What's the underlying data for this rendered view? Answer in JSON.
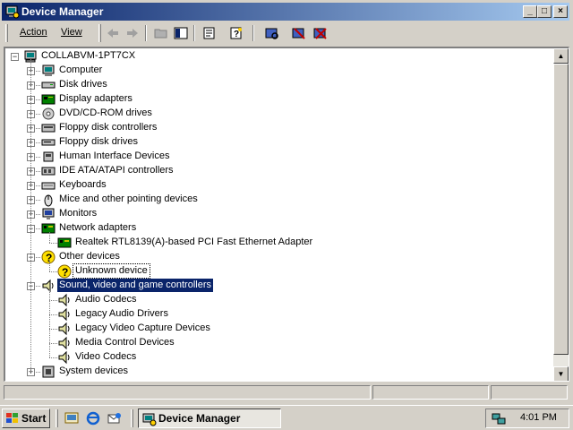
{
  "window": {
    "title": "Device Manager"
  },
  "menu": {
    "action": "Action",
    "view": "View"
  },
  "toolbar": {
    "buttons": [
      "back-icon",
      "forward-icon",
      "up-folder-icon",
      "show-hide-tree-icon",
      "properties-icon",
      "help-icon",
      "scan-hardware-icon",
      "disable-device-icon",
      "uninstall-device-icon"
    ]
  },
  "tree": {
    "root": "COLLABVM-1PT7CX",
    "categories": [
      {
        "label": "Computer",
        "icon": "computer-icon",
        "state": "collapsed"
      },
      {
        "label": "Disk drives",
        "icon": "disk-drive-icon",
        "state": "collapsed"
      },
      {
        "label": "Display adapters",
        "icon": "display-adapter-icon",
        "state": "collapsed"
      },
      {
        "label": "DVD/CD-ROM drives",
        "icon": "cdrom-icon",
        "state": "collapsed"
      },
      {
        "label": "Floppy disk controllers",
        "icon": "floppy-controller-icon",
        "state": "collapsed"
      },
      {
        "label": "Floppy disk drives",
        "icon": "floppy-drive-icon",
        "state": "collapsed"
      },
      {
        "label": "Human Interface Devices",
        "icon": "hid-icon",
        "state": "collapsed"
      },
      {
        "label": "IDE ATA/ATAPI controllers",
        "icon": "ide-controller-icon",
        "state": "collapsed"
      },
      {
        "label": "Keyboards",
        "icon": "keyboard-icon",
        "state": "collapsed"
      },
      {
        "label": "Mice and other pointing devices",
        "icon": "mouse-icon",
        "state": "collapsed"
      },
      {
        "label": "Monitors",
        "icon": "monitor-icon",
        "state": "collapsed"
      },
      {
        "label": "Network adapters",
        "icon": "network-adapter-icon",
        "state": "expanded",
        "children": [
          "Realtek RTL8139(A)-based PCI Fast Ethernet Adapter"
        ]
      },
      {
        "label": "Other devices",
        "icon": "question-icon",
        "state": "expanded",
        "children": [
          "Unknown device"
        ]
      },
      {
        "label": "Sound, video and game controllers",
        "icon": "speaker-icon",
        "state": "expanded",
        "selected": true,
        "children": [
          "Audio Codecs",
          "Legacy Audio Drivers",
          "Legacy Video Capture Devices",
          "Media Control Devices",
          "Video Codecs"
        ]
      },
      {
        "label": "System devices",
        "icon": "system-device-icon",
        "state": "collapsed"
      }
    ]
  },
  "taskbar": {
    "start": "Start",
    "quicklaunch": [
      "show-desktop-icon",
      "internet-explorer-icon",
      "outlook-express-icon"
    ],
    "task": "Device Manager",
    "clock": "4:01 PM"
  }
}
